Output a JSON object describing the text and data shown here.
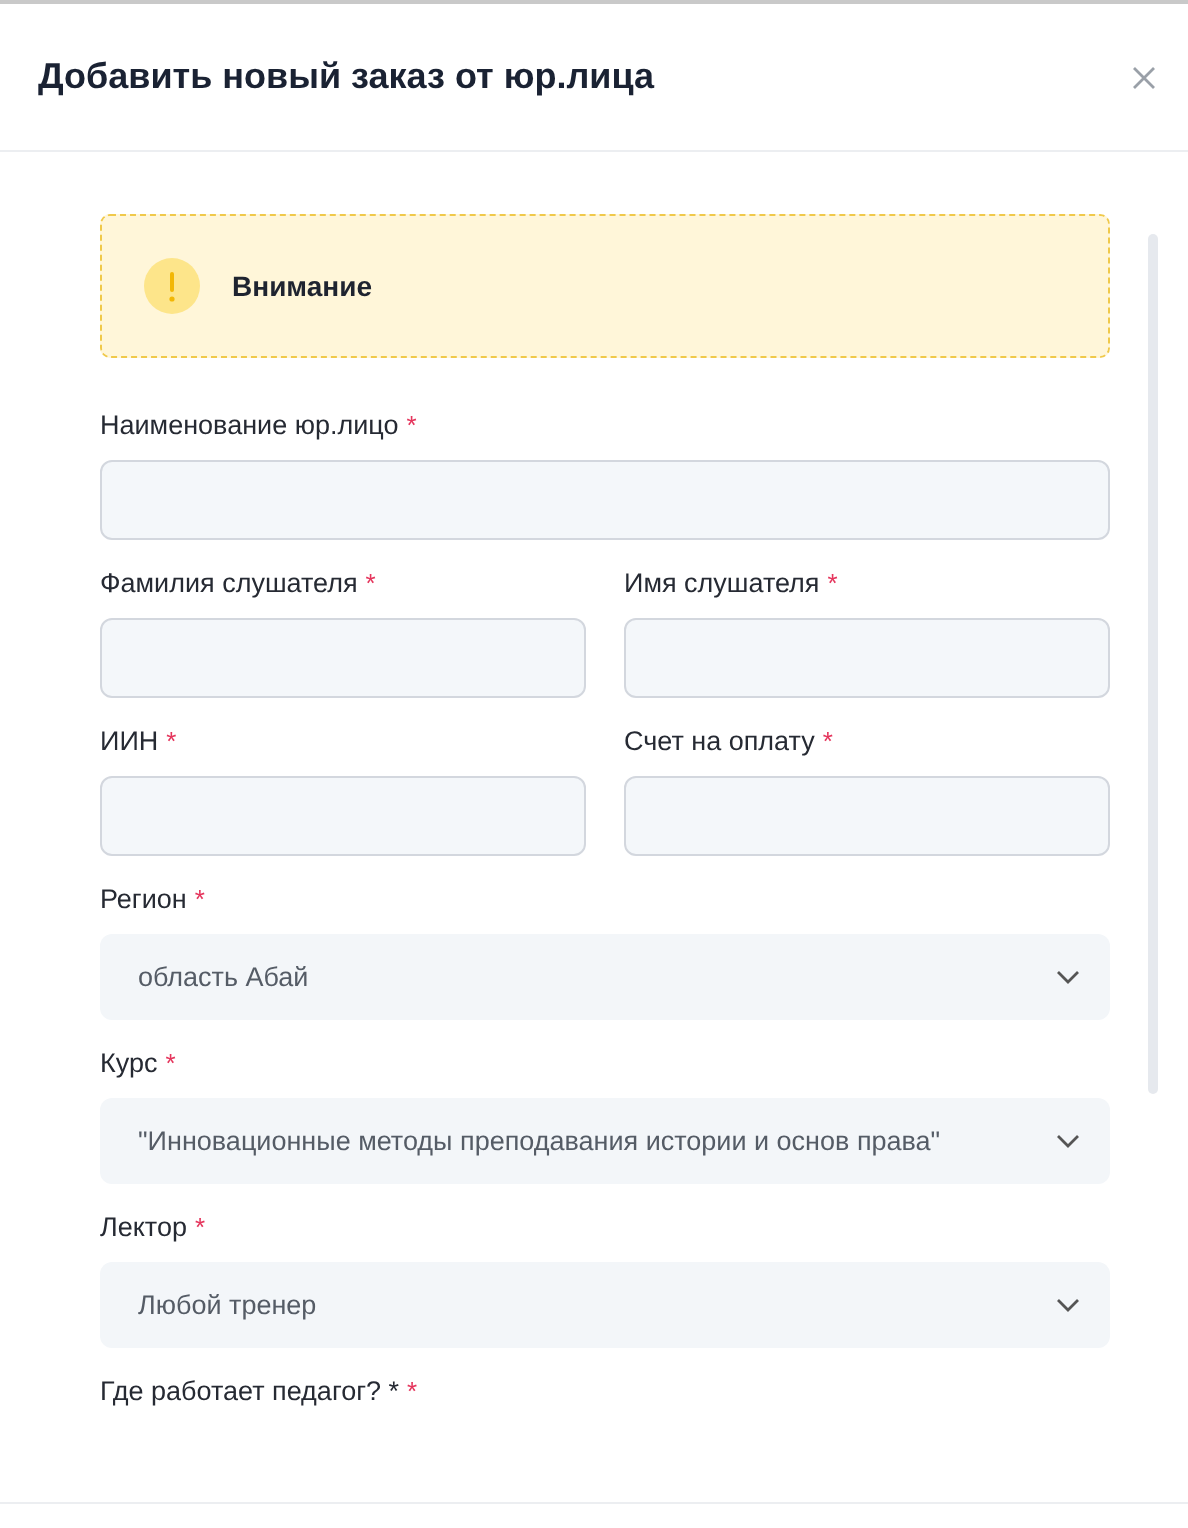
{
  "dialog": {
    "title": "Добавить новый заказ от юр.лица"
  },
  "alert": {
    "title": "Внимание"
  },
  "rows": [
    {
      "fields": [
        {
          "kind": "text",
          "label": "Наименование юр.лицо",
          "required_mark": "*"
        }
      ]
    },
    {
      "fields": [
        {
          "kind": "text",
          "label": "Фамилия слушателя",
          "required_mark": "*"
        },
        {
          "kind": "text",
          "label": "Имя слушателя",
          "required_mark": "*"
        }
      ]
    },
    {
      "fields": [
        {
          "kind": "text",
          "label": "ИИН",
          "required_mark": "*"
        },
        {
          "kind": "text",
          "label": "Счет на оплату",
          "required_mark": "*"
        }
      ]
    },
    {
      "fields": [
        {
          "kind": "select",
          "label": "Регион",
          "required_mark": "*",
          "value": "область Абай"
        }
      ]
    },
    {
      "fields": [
        {
          "kind": "select",
          "label": "Курс",
          "required_mark": "*",
          "value": "\"Инновационные методы преподавания истории и основ права\""
        }
      ]
    },
    {
      "fields": [
        {
          "kind": "select",
          "label": "Лектор",
          "required_mark": "*",
          "value": "Любой тренер"
        }
      ]
    },
    {
      "fields": [
        {
          "kind": "label",
          "label": "Где работает педагог? *",
          "required_mark": "*"
        }
      ]
    }
  ]
}
